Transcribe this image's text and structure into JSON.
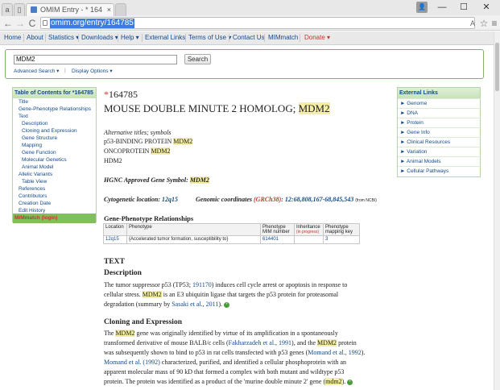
{
  "browser": {
    "tab1": "a",
    "tab2": "▯",
    "tab_active": "OMIM Entry - * 164",
    "tab_close": "×",
    "url": "omim.org/entry/164785",
    "back": "←",
    "forward": "→",
    "reload": "C",
    "minimize": "—",
    "maximize": "☐",
    "close": "✕",
    "profile": "👤",
    "star": "☆",
    "menu": "≡"
  },
  "nav": {
    "items": [
      "Home",
      "About",
      "Statistics ▾",
      "Downloads ▾",
      "Help ▾",
      "External Links",
      "Terms of Use ▾",
      "Contact Us",
      "MIMmatch",
      "Donate ▾"
    ]
  },
  "search": {
    "value": "MDM2",
    "button": "Search",
    "advanced": "Advanced Search ▾",
    "divider": "|",
    "display": "Display Options ▾"
  },
  "toc": {
    "title": "Table of Contents for *164785",
    "items": [
      "Title",
      "Gene-Phenotype Relationships",
      "Text",
      "Description",
      "Cloning and Expression",
      "Gene Structure",
      "Mapping",
      "Gene Function",
      "Molecular Genetics",
      "Animal Model",
      "Allelic Variants",
      "Table View",
      "References",
      "Contributors",
      "Creation Date",
      "Edit History"
    ],
    "footer": "MIMmatch (login)"
  },
  "external": {
    "title": "External Links",
    "items": [
      "Genome",
      "DNA",
      "Protein",
      "Gene Info",
      "Clinical Resources",
      "Variation",
      "Animal Models",
      "Cellular Pathways"
    ]
  },
  "entry": {
    "star": "*",
    "number": "164785",
    "title_pre": "MOUSE DOUBLE MINUTE 2 HOMOLOG; ",
    "title_gene": "MDM2",
    "alt_label": "Alternative titles; symbols",
    "alt1_pre": "p53-BINDING PROTEIN ",
    "alt2_pre": "ONCOPROTEIN ",
    "alt_gene": "MDM2",
    "alt3": "HDM2",
    "hgnc_label": "HGNC Approved Gene Symbol: ",
    "hgnc_value": "MDM2",
    "cyto_label": "Cytogenetic location: ",
    "cyto_value": "12q15",
    "coord_label": "Genomic coordinates ",
    "coord_build": "(GRCh38)",
    "coord_value": ": 12:68,808,167-68,845,543",
    "coord_source": "(from NCBI)"
  },
  "gpr": {
    "heading": "Gene-Phenotype Relationships",
    "h_location": "Location",
    "h_phenotype": "Phenotype",
    "h_mim1": "Phenotype",
    "h_mim2": "MIM number",
    "h_inh1": "Inheritance",
    "h_inh2": "(in progress)",
    "h_key1": "Phenotype",
    "h_key2": "mapping key",
    "r_location": "12q15",
    "r_phenotype": "{Accelerated tumor formation, susceptibility to}",
    "r_mim": "614401",
    "r_inh": "",
    "r_key": "3"
  },
  "text": {
    "heading": "TEXT",
    "desc_heading": "Description",
    "d1a": "The tumor suppressor p53 (TP53; ",
    "d1link": "191170",
    "d1b": ") induces cell cycle arrest or apoptosis in response to",
    "d2a": "cellular stress. ",
    "d2gene": "MDM2",
    "d2b": " is an E3 ubiquitin ligase that targets the p53 protein for proteasomal",
    "d3a": "degradation (summary by ",
    "d3link": "Sasaki et al., 2011",
    "d3b": ").",
    "clone_heading": "Cloning and Expression",
    "c1a": "The ",
    "c1gene": "MDM2",
    "c1b": " gene was originally identified by virtue of its amplification in a spontaneously",
    "c2a": "transformed derivative of mouse BALB/c cells (",
    "c2link": "Fakharzadeh et al., 1991",
    "c2b": "), and the ",
    "c2gene": "MDM2",
    "c2c": " protein",
    "c3a": "was subsequently shown to bind to p53 in rat cells transfected with p53 genes (",
    "c3link": "Momand et al., 1992",
    "c3b": ").",
    "c4link": "Momand et al. (1992)",
    "c4b": " characterized, purified, and identified a cellular phosphoprotein with an",
    "c5": "apparent molecular mass of 90 kD that formed a complex with both mutant and wildtype p53",
    "c6a": "protein. The protein was identified as a product of the 'murine double minute 2' gene (",
    "c6gene": "mdm2",
    "c6b": ")."
  },
  "plus_glyph": "+",
  "colors": {
    "link": "#134a8a",
    "highlight": "#f5efa3",
    "accent_green": "#7fbf5e",
    "red": "#c0392b"
  }
}
